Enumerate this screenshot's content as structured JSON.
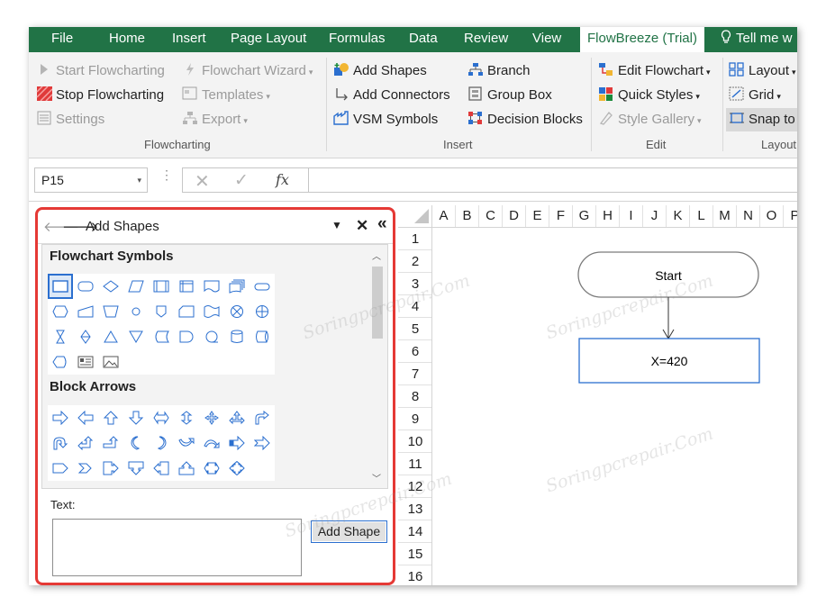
{
  "menu": {
    "tabs": [
      "File",
      "Home",
      "Insert",
      "Page Layout",
      "Formulas",
      "Data",
      "Review",
      "View",
      "FlowBreeze (Trial)"
    ],
    "tell_me": "Tell me w"
  },
  "ribbon": {
    "flowcharting": {
      "start": "Start Flowcharting",
      "stop": "Stop Flowcharting",
      "settings": "Settings",
      "wizard": "Flowchart Wizard",
      "templates": "Templates",
      "export": "Export",
      "label": "Flowcharting"
    },
    "insert": {
      "add_shapes": "Add Shapes",
      "add_connectors": "Add Connectors",
      "vsm": "VSM Symbols",
      "branch": "Branch",
      "group_box": "Group Box",
      "decision_blocks": "Decision Blocks",
      "label": "Insert"
    },
    "edit": {
      "edit_flowchart": "Edit Flowchart",
      "quick_styles": "Quick Styles",
      "style_gallery": "Style Gallery",
      "label": "Edit"
    },
    "layout": {
      "layout": "Layout",
      "grid": "Grid",
      "snap_to": "Snap to",
      "label": "Layout"
    }
  },
  "formula_bar": {
    "name_box": "P15",
    "fx": "fx",
    "value": ""
  },
  "pane": {
    "title": "Add Shapes",
    "sections": [
      "Flowchart Symbols",
      "Block Arrows"
    ],
    "text_label": "Text:",
    "text_value": "",
    "add_button": "Add Shape"
  },
  "sheet": {
    "columns": [
      "A",
      "B",
      "C",
      "D",
      "E",
      "F",
      "G",
      "H",
      "I",
      "J",
      "K",
      "L",
      "M",
      "N",
      "O",
      "P"
    ],
    "rows": [
      "1",
      "2",
      "3",
      "4",
      "5",
      "6",
      "7",
      "8",
      "9",
      "10",
      "11",
      "12",
      "13",
      "14",
      "15",
      "16"
    ],
    "shapes": {
      "start": "Start",
      "process": "X=420"
    }
  },
  "watermark": "Soringpcrepair.Com",
  "colors": {
    "menu_bg": "#217346",
    "highlight_border": "#e53935",
    "selection_blue": "#2b6fcf"
  }
}
